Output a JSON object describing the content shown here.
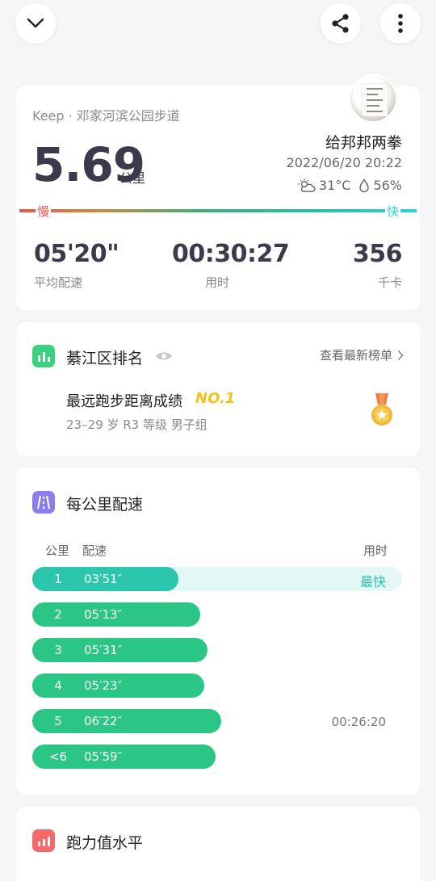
{
  "topbar": {
    "back_icon": "chevron-down-icon",
    "share_icon": "share-icon",
    "more_icon": "more-vertical-icon"
  },
  "summary": {
    "source": "Keep · 邓家河滨公园步道",
    "distance": "5.69",
    "distance_unit": "公里",
    "user_name": "给邦邦两拳",
    "datetime": "2022/06/20 20:22",
    "weather_icon": "partly-cloudy-icon",
    "temperature": "31°C",
    "humidity_icon": "droplet-icon",
    "humidity": "56%",
    "pace_slow_label": "慢",
    "pace_fast_label": "快",
    "stats": [
      {
        "value": "05'20\"",
        "label": "平均配速"
      },
      {
        "value": "00:30:27",
        "label": "用时"
      },
      {
        "value": "356",
        "label": "千卡"
      }
    ]
  },
  "ranking": {
    "title": "綦江区排名",
    "eye_icon": "eye-icon",
    "link_label": "查看最新榜单",
    "achievement": "最远跑步距离成绩",
    "rank_badge": "NO.1",
    "group": "23–29 岁 R3 等级 男子组",
    "medal_icon": "gold-medal-icon"
  },
  "splits": {
    "title": "每公里配速",
    "col_km": "公里",
    "col_pace": "配速",
    "col_time": "用时",
    "fastest_label": "最快",
    "rows": [
      {
        "km": "1",
        "pace": "03′51″",
        "ratio": 0.396
      },
      {
        "km": "2",
        "pace": "05′13″",
        "ratio": 0.455
      },
      {
        "km": "3",
        "pace": "05′31″",
        "ratio": 0.473
      },
      {
        "km": "4",
        "pace": "05′23″",
        "ratio": 0.466
      },
      {
        "km": "5",
        "pace": "06′22″",
        "ratio": 0.512
      },
      {
        "km": "<6",
        "pace": "05′59″",
        "ratio": 0.495
      }
    ],
    "cumulative_time": "00:26:20"
  },
  "running_level": {
    "title": "跑力值水平"
  },
  "colors": {
    "accent_green": "#2bc585",
    "accent_teal": "#2bc6ac",
    "gold": "#f2c21c",
    "slow_red": "#e9554b"
  }
}
